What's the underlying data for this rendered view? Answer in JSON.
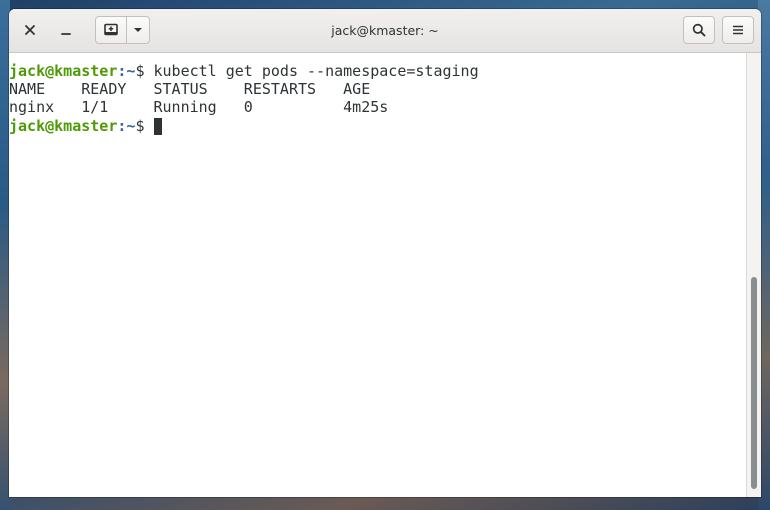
{
  "window": {
    "title": "jack@kmaster: ~"
  },
  "titlebar": {
    "close_icon": "close-icon",
    "minimize_icon": "minimize-icon",
    "new_tab_icon": "new-tab-icon",
    "tab_menu_icon": "chevron-down-icon",
    "search_icon": "search-icon",
    "menu_icon": "hamburger-menu-icon"
  },
  "terminal": {
    "prompt_user_host": "jack@kmaster",
    "prompt_path": ":~",
    "prompt_symbol": "$ ",
    "command": "kubectl get pods --namespace=staging",
    "header_line": "NAME    READY   STATUS    RESTARTS   AGE",
    "rows": [
      "nginx   1/1     Running   0          4m25s"
    ]
  },
  "colors": {
    "prompt_user": "#4e9a06",
    "prompt_path": "#3465a4",
    "text": "#2e3436"
  }
}
